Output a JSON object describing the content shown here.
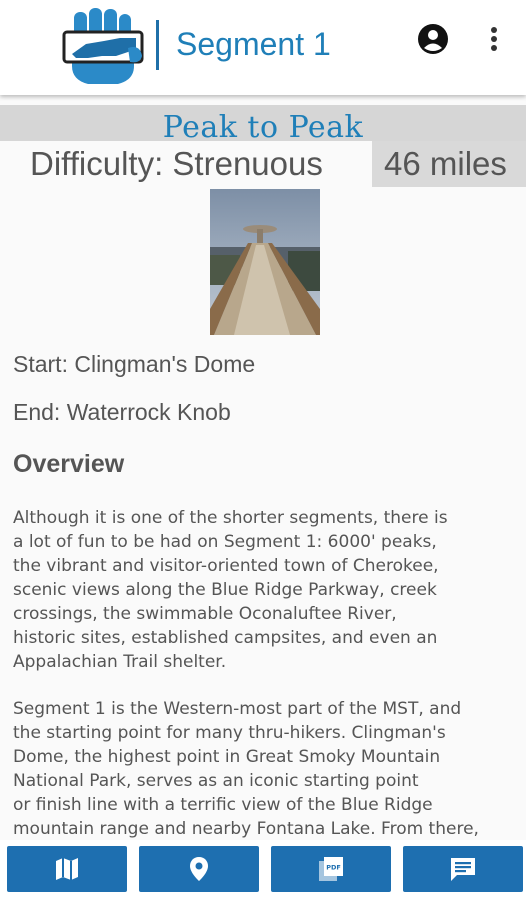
{
  "header": {
    "title": "Segment 1",
    "logo_icon": "nc-state-hand-logo-icon",
    "account_icon": "account-circle-icon",
    "menu_icon": "more-vert-icon"
  },
  "segment": {
    "name": "Peak to Peak",
    "difficulty": "Difficulty: Strenuous",
    "distance": "46 miles",
    "photo_icon": "clingmans-dome-photo",
    "start": "Start: Clingman's Dome",
    "end": "End: Waterrock Knob"
  },
  "overview": {
    "heading": "Overview",
    "paragraph_1": "Although it is one of the shorter segments, there is\na lot of fun to be had on Segment 1: 6000' peaks,\nthe vibrant and visitor-oriented town of Cherokee,\nscenic views along the Blue Ridge Parkway, creek\ncrossings, the swimmable Oconaluftee River,\nhistoric sites, established campsites, and even an\nAppalachian Trail shelter.",
    "paragraph_2": "Segment 1 is the Western-most part of the MST, and\nthe starting point for many thru-hikers. Clingman's\nDome, the highest point in Great Smoky Mountain\nNational Park, serves as an iconic starting point\nor finish line with a terrific view of the Blue Ridge\nmountain range and nearby Fontana Lake. From there,"
  },
  "bottom_nav": {
    "buttons": [
      {
        "icon": "map-icon"
      },
      {
        "icon": "location-pin-icon"
      },
      {
        "icon": "pdf-icon"
      },
      {
        "icon": "message-icon"
      }
    ]
  },
  "colors": {
    "brand_blue": "#1f7fb8",
    "nav_button": "#1e6fb0",
    "band_gray": "#d6d6d6"
  }
}
